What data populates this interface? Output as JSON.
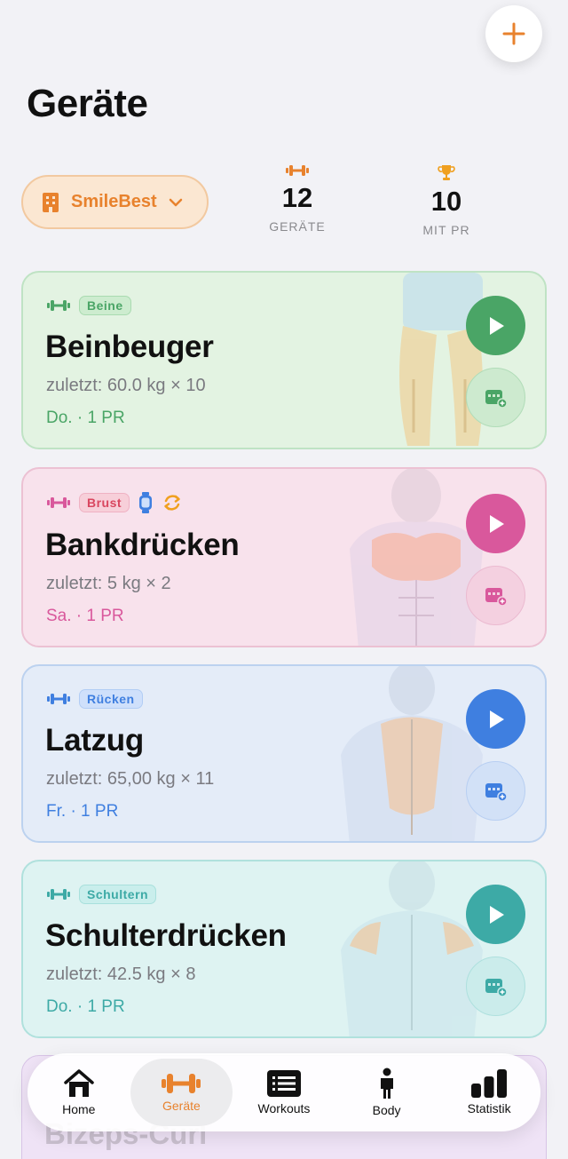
{
  "header": {
    "title": "Geräte",
    "add_icon": "plus-icon"
  },
  "gym_selector": {
    "name": "SmileBest",
    "icon": "building-icon",
    "chevron": "chevron-down-icon"
  },
  "stats": [
    {
      "value": "12",
      "label": "GERÄTE",
      "icon": "dumbbell-icon"
    },
    {
      "value": "10",
      "label": "MIT PR",
      "icon": "trophy-icon"
    }
  ],
  "cards": [
    {
      "tag": "Beine",
      "name": "Beinbeuger",
      "last": "zuletzt: 60.0 kg × 10",
      "meta": "Do. · 1 PR",
      "accent": "#4aa566"
    },
    {
      "tag": "Brust",
      "name": "Bankdrücken",
      "last": "zuletzt: 5 kg × 2",
      "meta": "Sa. · 1 PR",
      "accent": "#d9589c"
    },
    {
      "tag": "Rücken",
      "name": "Latzug",
      "last": "zuletzt: 65,00 kg × 11",
      "meta": "Fr. · 1 PR",
      "accent": "#3f7fe0"
    },
    {
      "tag": "Schultern",
      "name": "Schulterdrücken",
      "last": "zuletzt: 42.5 kg × 8",
      "meta": "Do. · 1 PR",
      "accent": "#3daaa6"
    }
  ],
  "peek_card": {
    "name": "Bizeps-Curl"
  },
  "tabbar": {
    "items": [
      {
        "label": "Home",
        "icon": "house-icon"
      },
      {
        "label": "Geräte",
        "icon": "dumbbell-icon"
      },
      {
        "label": "Workouts",
        "icon": "list-icon"
      },
      {
        "label": "Body",
        "icon": "person-icon"
      },
      {
        "label": "Statistik",
        "icon": "bar-chart-icon"
      }
    ]
  },
  "colors": {
    "accent": "#e8822d",
    "background": "#f2f2f6"
  }
}
